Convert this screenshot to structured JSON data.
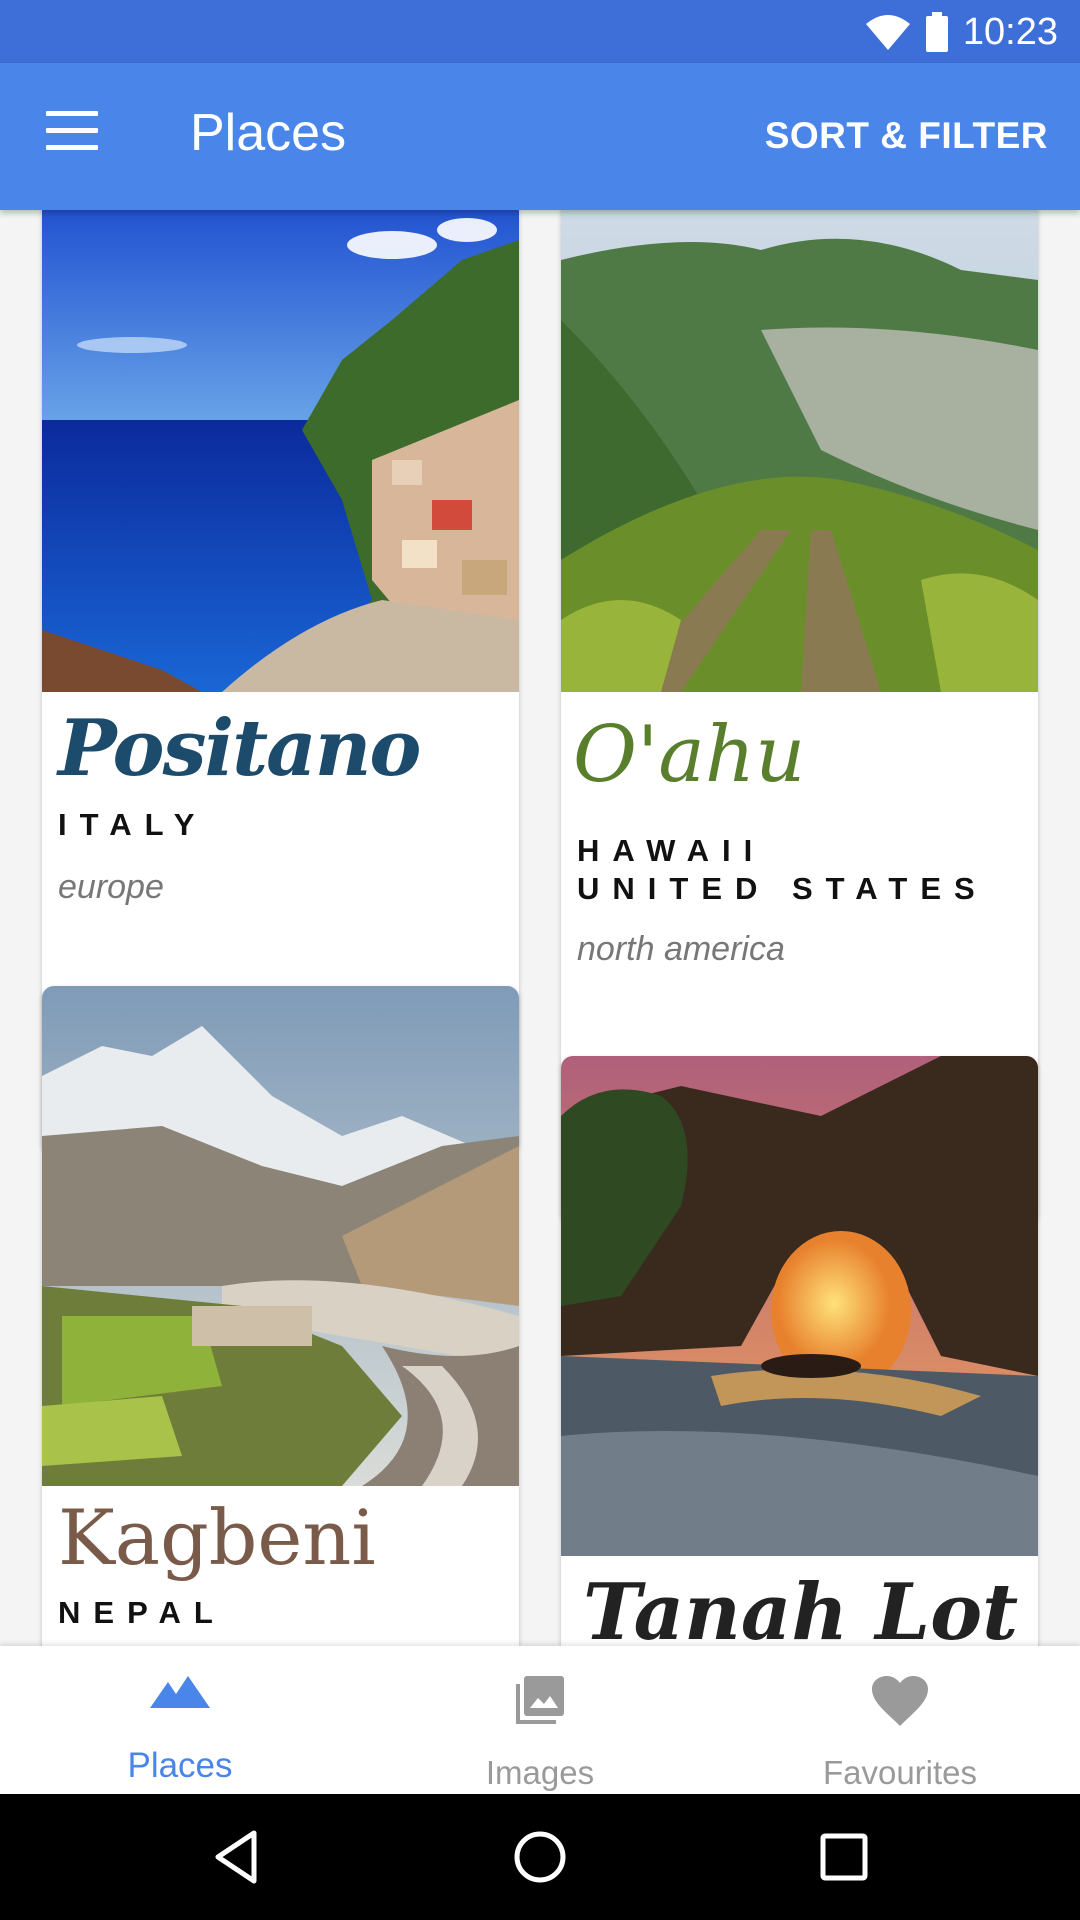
{
  "status_bar": {
    "time": "10:23",
    "icons": [
      "wifi-icon",
      "battery-icon"
    ]
  },
  "app_bar": {
    "title": "Places",
    "sort_filter_label": "SORT & FILTER",
    "menu_icon": "menu-icon"
  },
  "places": [
    {
      "name": "Positano",
      "country_lines": [
        "ITALY"
      ],
      "continent": "europe",
      "name_color": "#1d4b6b"
    },
    {
      "name": "O'ahu",
      "country_lines": [
        "HAWAII",
        "UNITED STATES"
      ],
      "continent": "north america",
      "name_color": "#5a7f2c"
    },
    {
      "name": "Kagbeni",
      "country_lines": [
        "NEPAL"
      ],
      "continent": "",
      "name_color": "#7a5a48"
    },
    {
      "name": "Tanah Lot",
      "country_lines": [],
      "continent": "",
      "name_color": "#222222"
    }
  ],
  "bottom_nav": [
    {
      "label": "Places",
      "icon": "mountain-icon",
      "active": true
    },
    {
      "label": "Images",
      "icon": "photo-library-icon",
      "active": false
    },
    {
      "label": "Favourites",
      "icon": "heart-icon",
      "active": false
    }
  ],
  "colors": {
    "primary": "#4a86ea",
    "status_bar": "#3e6fd8",
    "active_nav": "#4a86ea",
    "inactive_nav": "#9a9a9a"
  },
  "system_nav": [
    "back-icon",
    "home-icon",
    "recents-icon"
  ]
}
